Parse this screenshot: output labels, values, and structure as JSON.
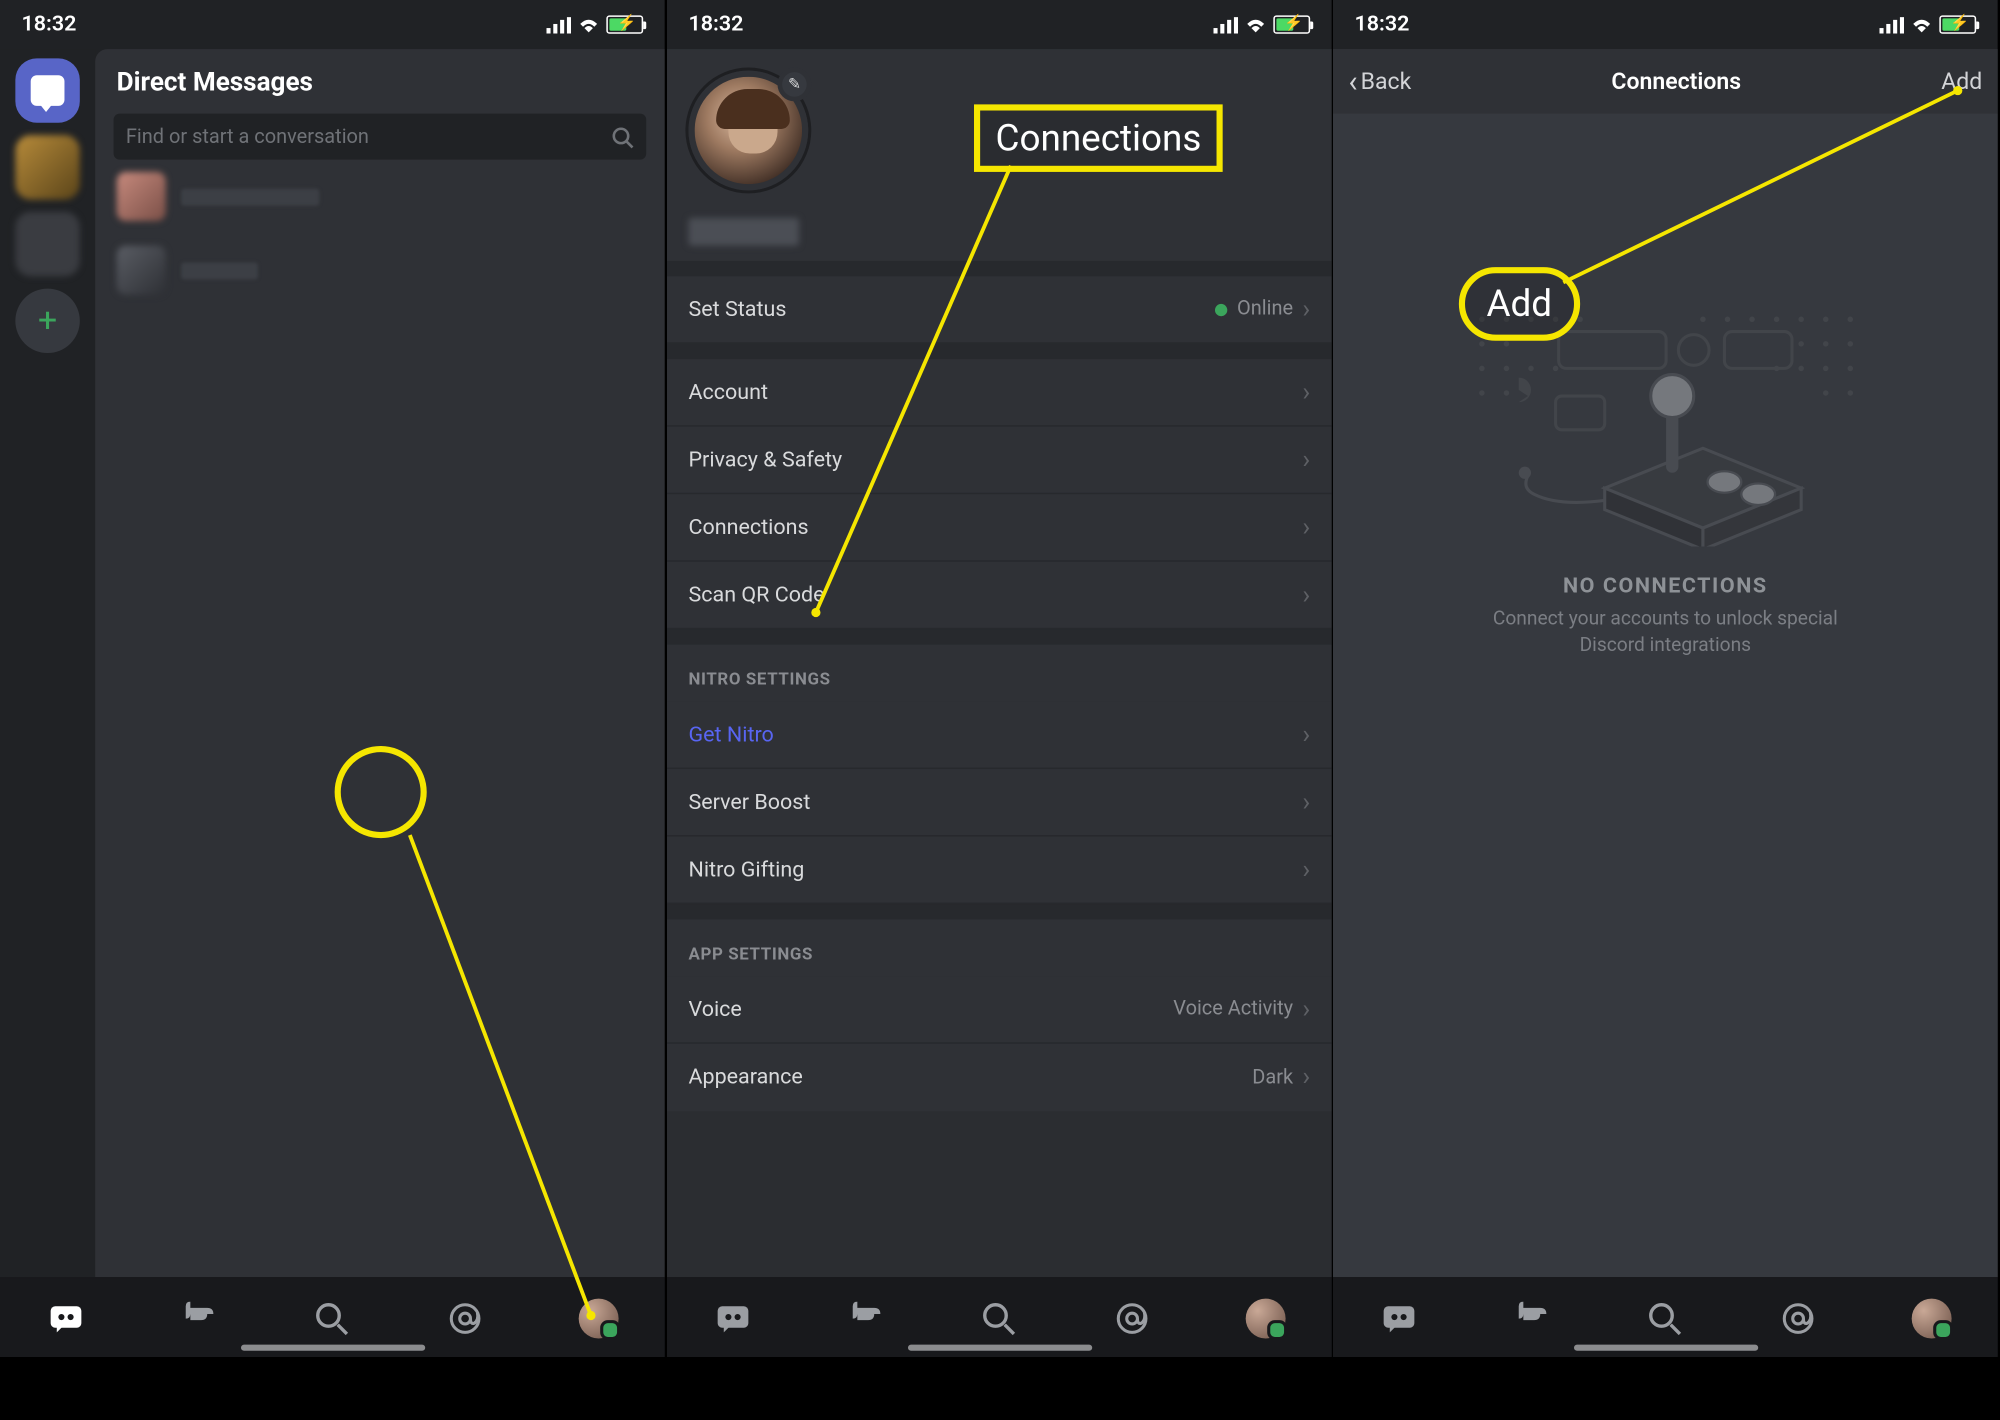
{
  "status": {
    "time": "18:32"
  },
  "screen1": {
    "dm_title": "Direct Messages",
    "search_placeholder": "Find or start a conversation"
  },
  "screen2": {
    "status_row": {
      "label": "Set Status",
      "value": "Online"
    },
    "rows1": [
      {
        "label": "Account"
      },
      {
        "label": "Privacy & Safety"
      },
      {
        "label": "Connections"
      },
      {
        "label": "Scan QR Code"
      }
    ],
    "nitro_header": "NITRO SETTINGS",
    "rows_nitro": [
      {
        "label": "Get Nitro"
      },
      {
        "label": "Server Boost"
      },
      {
        "label": "Nitro Gifting"
      }
    ],
    "app_header": "APP SETTINGS",
    "rows_app": [
      {
        "label": "Voice",
        "value": "Voice Activity"
      },
      {
        "label": "Appearance",
        "value": "Dark"
      }
    ]
  },
  "screen3": {
    "back": "Back",
    "title": "Connections",
    "add": "Add",
    "empty_title": "NO CONNECTIONS",
    "empty_sub": "Connect your accounts to unlock special Discord integrations"
  },
  "annotations": {
    "callout_connections": "Connections",
    "callout_add": "Add"
  }
}
